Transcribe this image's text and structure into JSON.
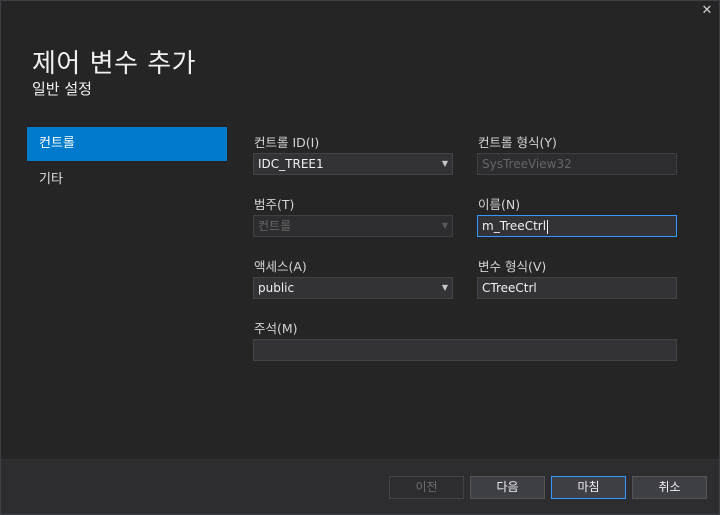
{
  "window": {
    "close_glyph": "✕"
  },
  "header": {
    "title": "제어 변수 추가",
    "subtitle": "일반 설정"
  },
  "sidebar": {
    "items": [
      {
        "label": "컨트롤",
        "active": true
      },
      {
        "label": "기타",
        "active": false
      }
    ]
  },
  "form": {
    "control_id": {
      "label": "컨트롤 ID(I)",
      "value": "IDC_TREE1"
    },
    "control_type": {
      "label": "컨트롤 형식(Y)",
      "value": "SysTreeView32"
    },
    "category": {
      "label": "범주(T)",
      "value": "컨트롤"
    },
    "name": {
      "label": "이름(N)",
      "value": "m_TreeCtrl"
    },
    "access": {
      "label": "액세스(A)",
      "value": "public"
    },
    "variable_type": {
      "label": "변수 형식(V)",
      "value": "CTreeCtrl"
    },
    "comment": {
      "label": "주석(M)",
      "value": ""
    }
  },
  "buttons": {
    "prev": "이전",
    "next": "다음",
    "finish": "마침",
    "cancel": "취소"
  },
  "colors": {
    "accent": "#007acc",
    "background": "#252526",
    "focus_border": "#3399ff"
  }
}
